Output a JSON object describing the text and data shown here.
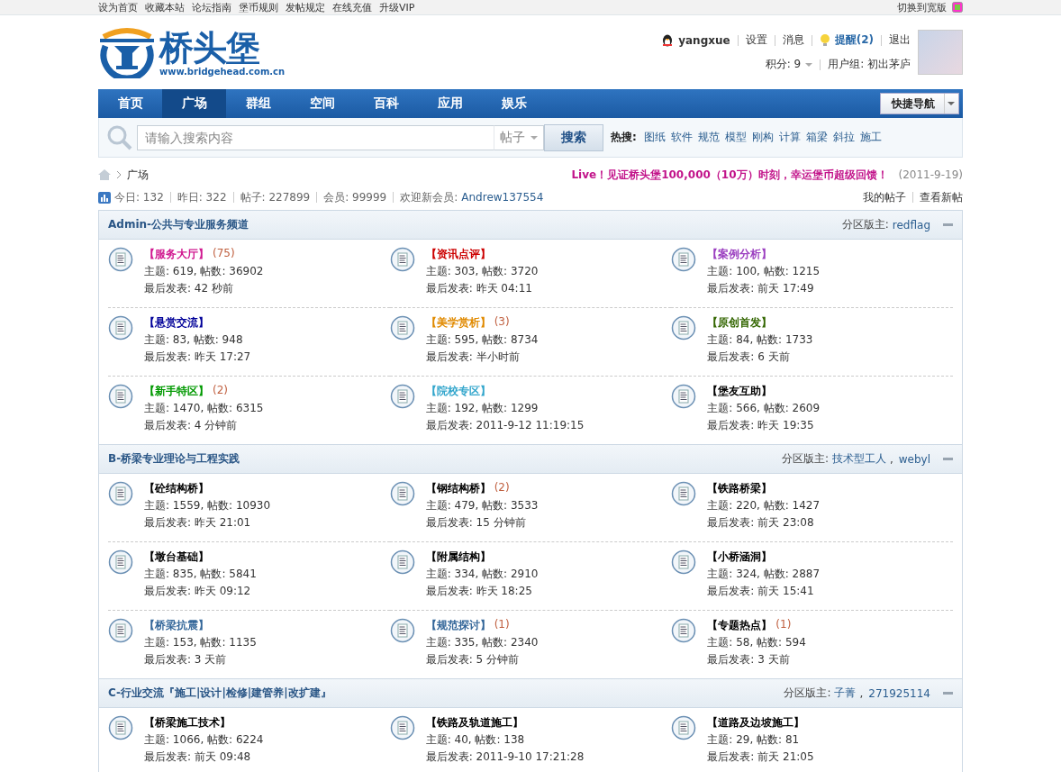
{
  "top_links": [
    "设为首页",
    "收藏本站",
    "论坛指南",
    "堡币规则",
    "发帖规定",
    "在线充值",
    "升级VIP"
  ],
  "wide_toggle": "切换到宽版",
  "logo": {
    "name": "桥头堡",
    "url": "www.bridgehead.com.cn"
  },
  "user": {
    "name": "yangxue",
    "links": [
      "设置",
      "消息"
    ],
    "reminder": "提醒(2)",
    "logout": "退出",
    "points": "积分: 9",
    "group": "用户组: 初出茅庐"
  },
  "nav": [
    {
      "label": "首页",
      "selected": false
    },
    {
      "label": "广场",
      "selected": true
    },
    {
      "label": "群组",
      "selected": false
    },
    {
      "label": "空间",
      "selected": false
    },
    {
      "label": "百科",
      "selected": false
    },
    {
      "label": "应用",
      "selected": false
    },
    {
      "label": "娱乐",
      "selected": false
    }
  ],
  "quick_nav": "快捷导航",
  "search": {
    "placeholder": "请输入搜索内容",
    "scope": "帖子",
    "button": "搜索",
    "hot_label": "热搜:",
    "hot": [
      "图纸",
      "软件",
      "规范",
      "模型",
      "刚构",
      "计算",
      "箱梁",
      "斜拉",
      "施工"
    ]
  },
  "breadcrumb": "广场",
  "announcement": {
    "text": "Live！见证桥头堡100,000（10万）时刻，幸运堡币超级回馈！",
    "date": "(2011-9-19)"
  },
  "stats": [
    "今日: 132",
    "昨日: 322",
    "帖子: 227899",
    "会员: 99999"
  ],
  "welcome": {
    "label": "欢迎新会员:",
    "member": "Andrew137554"
  },
  "quick_links": [
    "我的帖子",
    "查看新帖"
  ],
  "moderator_separator": ",",
  "sections": [
    {
      "title": "Admin-公共与专业服务频道",
      "moderator_label": "分区版主:",
      "moderators": [
        "redflag"
      ],
      "forums": [
        {
          "name": "【服务大厅】",
          "color": "#d0178f",
          "count": "(75)",
          "stats": "主题: 619, 帖数: 36902",
          "last": "最后发表: 42 秒前"
        },
        {
          "name": "【资讯点评】",
          "color": "#cc0000",
          "stats": "主题: 303, 帖数: 3720",
          "last": "最后发表: 昨天 04:11"
        },
        {
          "name": "【案例分析】",
          "color": "#9b3fc0",
          "stats": "主题: 100, 帖数: 1215",
          "last": "最后发表: 前天 17:49"
        },
        {
          "name": "【悬赏交流】",
          "color": "#000099",
          "stats": "主题: 83, 帖数: 948",
          "last": "最后发表: 昨天 17:27"
        },
        {
          "name": "【美学赏析】",
          "color": "#e08a00",
          "count": "(3)",
          "stats": "主题: 595, 帖数: 8734",
          "last": "最后发表: 半小时前"
        },
        {
          "name": "【原创首发】",
          "color": "#336600",
          "stats": "主题: 84, 帖数: 1733",
          "last": "最后发表: 6 天前"
        },
        {
          "name": "【新手特区】",
          "color": "#009900",
          "count": "(2)",
          "stats": "主题: 1470, 帖数: 6315",
          "last": "最后发表: 4 分钟前"
        },
        {
          "name": "【院校专区】",
          "color": "#33a6cc",
          "stats": "主题: 192, 帖数: 1299",
          "last": "最后发表: 2011-9-12 11:19:15"
        },
        {
          "name": "【堡友互助】",
          "color": "#000000",
          "stats": "主题: 566, 帖数: 2609",
          "last": "最后发表: 昨天 19:35"
        }
      ]
    },
    {
      "title": "B-桥梁专业理论与工程实践",
      "moderator_label": "分区版主:",
      "moderators": [
        "技术型工人",
        "webyl"
      ],
      "forums": [
        {
          "name": "【砼结构桥】",
          "color": "#000000",
          "stats": "主题: 1559, 帖数: 10930",
          "last": "最后发表: 昨天 21:01"
        },
        {
          "name": "【钢结构桥】",
          "color": "#000000",
          "count": "(2)",
          "stats": "主题: 479, 帖数: 3533",
          "last": "最后发表: 15 分钟前"
        },
        {
          "name": "【铁路桥梁】",
          "color": "#000000",
          "stats": "主题: 220, 帖数: 1427",
          "last": "最后发表: 前天 23:08"
        },
        {
          "name": "【墩台基础】",
          "color": "#000000",
          "stats": "主题: 835, 帖数: 5841",
          "last": "最后发表: 昨天 09:12"
        },
        {
          "name": "【附属结构】",
          "color": "#000000",
          "stats": "主题: 334, 帖数: 2910",
          "last": "最后发表: 昨天 18:25"
        },
        {
          "name": "【小桥涵洞】",
          "color": "#000000",
          "stats": "主题: 324, 帖数: 2887",
          "last": "最后发表: 前天 15:41"
        },
        {
          "name": "【桥梁抗震】",
          "color": "#336699",
          "stats": "主题: 153, 帖数: 1135",
          "last": "最后发表: 3 天前"
        },
        {
          "name": "【规范探讨】",
          "color": "#336699",
          "count": "(1)",
          "stats": "主题: 335, 帖数: 2340",
          "last": "最后发表: 5 分钟前"
        },
        {
          "name": "【专题热点】",
          "color": "#000000",
          "count": "(1)",
          "stats": "主题: 58, 帖数: 594",
          "last": "最后发表: 3 天前"
        }
      ]
    },
    {
      "title": "C-行业交流『施工|设计|检修|建管养|改扩建』",
      "moderator_label": "分区版主:",
      "moderators": [
        "子菁",
        "271925114"
      ],
      "forums": [
        {
          "name": "【桥梁施工技术】",
          "color": "#000000",
          "stats": "主题: 1066, 帖数: 6224",
          "last": "最后发表: 前天 09:48"
        },
        {
          "name": "【铁路及轨道施工】",
          "color": "#000000",
          "stats": "主题: 40, 帖数: 138",
          "last": "最后发表: 2011-9-10 17:21:28"
        },
        {
          "name": "【道路及边坡施工】",
          "color": "#000000",
          "stats": "主题: 29, 帖数: 81",
          "last": "最后发表: 前天 21:05"
        }
      ]
    }
  ]
}
